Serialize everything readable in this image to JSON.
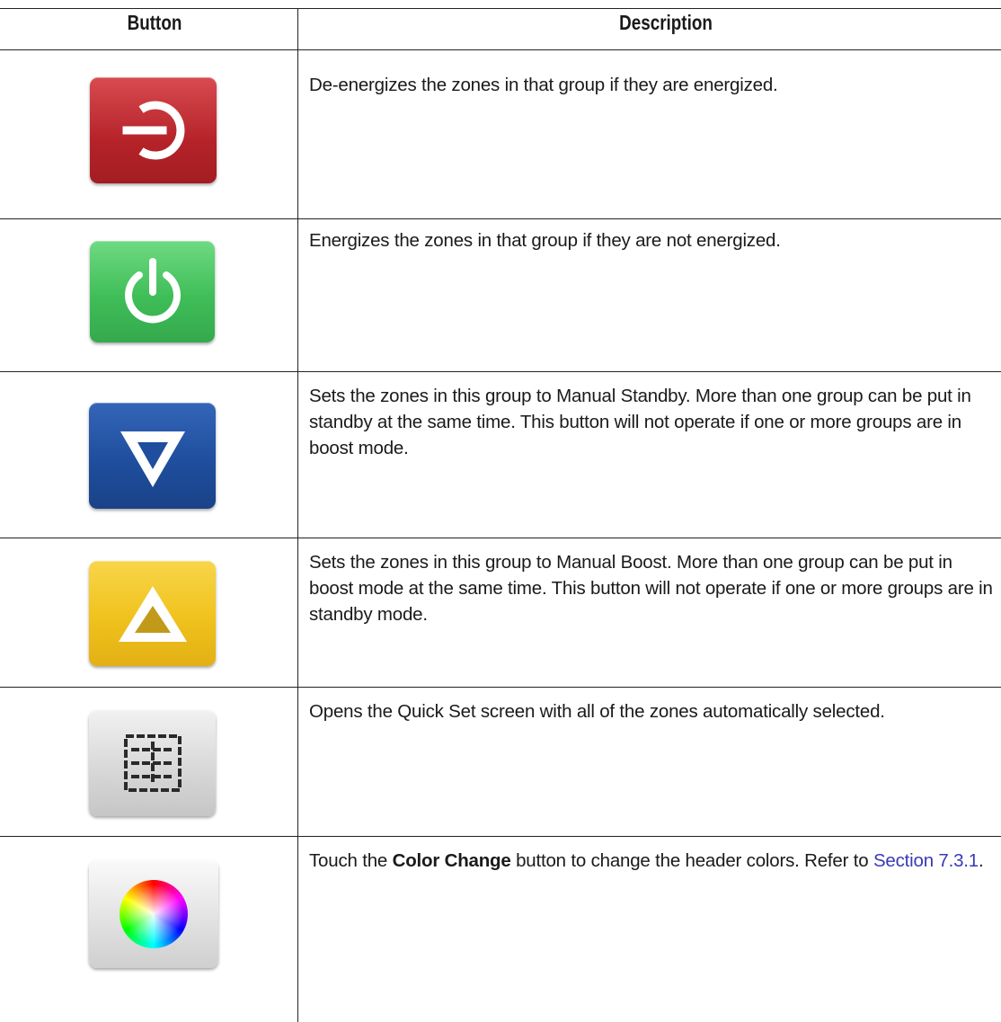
{
  "header": {
    "button_col": "Button",
    "description_col": "Description"
  },
  "rows": [
    {
      "icon": "power-off-icon",
      "color": "#c0272d",
      "description": "De-energizes the zones in that group if they are energized."
    },
    {
      "icon": "power-on-icon",
      "color": "#3fbf5a",
      "description": "Energizes the zones in that group if they are not energized."
    },
    {
      "icon": "standby-icon",
      "color": "#1f4fa0",
      "description": "Sets the zones in this group to Manual Standby. More than one group can be put in standby at the same time. This button will not operate if one or more groups are in boost mode."
    },
    {
      "icon": "boost-icon",
      "color": "#f2c21c",
      "description": "Sets the zones in this group to Manual Boost. More than one group can be put in boost mode at the same time. This button will not operate if one or more groups are in standby mode."
    },
    {
      "icon": "quick-set-icon",
      "color": "#d9d9d9",
      "description": "Opens the Quick Set screen with all of the zones automatically selected."
    },
    {
      "icon": "color-wheel-icon",
      "color": "#e3e3e3",
      "description_pre": "Touch the ",
      "description_bold": "Color Change",
      "description_post": " button to change the header colors. Refer to ",
      "link_text": "Section 7.3.1",
      "description_end": "."
    }
  ]
}
